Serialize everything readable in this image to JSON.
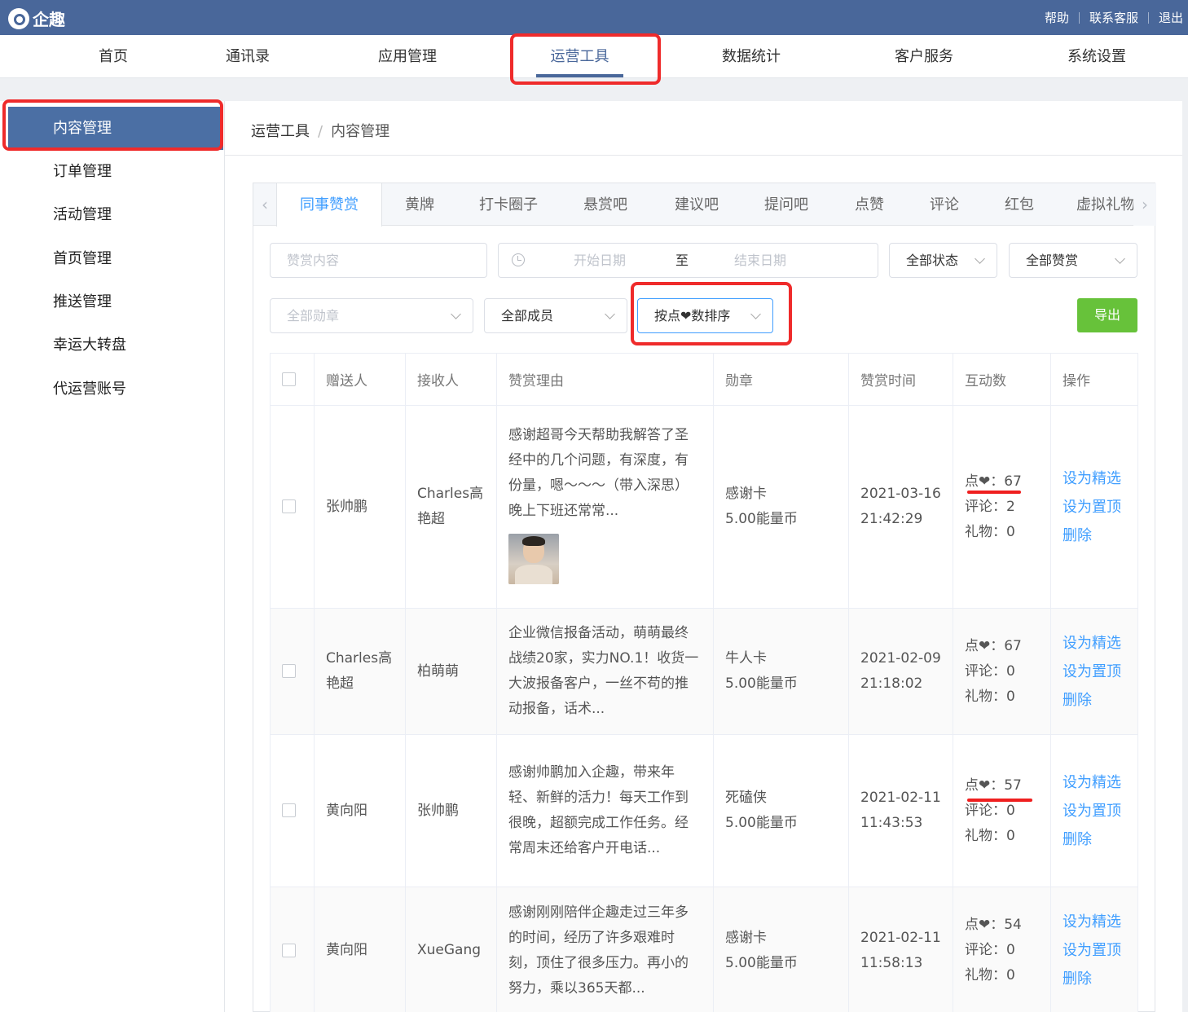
{
  "header": {
    "logo_text": "企趣",
    "links": [
      "帮助",
      "联系客服",
      "退出"
    ]
  },
  "nav": {
    "items": [
      "首页",
      "通讯录",
      "应用管理",
      "运营工具",
      "数据统计",
      "客户服务",
      "系统设置"
    ],
    "active": "运营工具"
  },
  "sidebar": {
    "items": [
      "内容管理",
      "订单管理",
      "活动管理",
      "首页管理",
      "推送管理",
      "幸运大转盘",
      "代运营账号"
    ],
    "active": "内容管理"
  },
  "breadcrumb": {
    "parent": "运营工具",
    "separator": "/",
    "current": "内容管理"
  },
  "tabs": {
    "items": [
      "同事赞赏",
      "黄牌",
      "打卡圈子",
      "悬赏吧",
      "建议吧",
      "提问吧",
      "点赞",
      "评论",
      "红包",
      "虚拟礼物"
    ],
    "active": "同事赞赏"
  },
  "filters": {
    "content_placeholder": "赞赏内容",
    "start_date_placeholder": "开始日期",
    "date_separator": "至",
    "end_date_placeholder": "结束日期",
    "status": "全部状态",
    "praise_type": "全部赞赏",
    "medal_placeholder": "全部勋章",
    "member": "全部成员",
    "sort": "按点❤数排序",
    "export_label": "导出"
  },
  "table": {
    "headers": [
      "赠送人",
      "接收人",
      "赞赏理由",
      "勋章",
      "赞赏时间",
      "互动数",
      "操作"
    ],
    "rows": [
      {
        "sender": "张帅鹏",
        "receiver": "Charles高艳超",
        "reason": "感谢超哥今天帮助我解答了圣经中的几个问题，有深度，有份量，嗯～～～（带入深思） 晚上下班还常常...",
        "has_image": true,
        "medal": "感谢卡",
        "coins": "5.00能量币",
        "date": "2021-03-16",
        "time": "21:42:29",
        "likes": "点❤：67",
        "comments": "评论：2",
        "gifts": "礼物：0"
      },
      {
        "sender": "Charles高艳超",
        "receiver": "柏萌萌",
        "reason": "企业微信报备活动，萌萌最终战绩20家，实力NO.1！收货一大波报备客户，一丝不苟的推动报备，话术...",
        "has_image": false,
        "medal": "牛人卡",
        "coins": "5.00能量币",
        "date": "2021-02-09",
        "time": "21:18:02",
        "likes": "点❤：67",
        "comments": "评论：0",
        "gifts": "礼物：0"
      },
      {
        "sender": "黄向阳",
        "receiver": "张帅鹏",
        "reason": "感谢帅鹏加入企趣，带来年轻、新鲜的活力！每天工作到很晚，超额完成工作任务。经常周末还给客户开电话...",
        "has_image": false,
        "medal": "死磕侠",
        "coins": "5.00能量币",
        "date": "2021-02-11",
        "time": "11:43:53",
        "likes": "点❤：57",
        "comments": "评论：0",
        "gifts": "礼物：0"
      },
      {
        "sender": "黄向阳",
        "receiver": "XueGang",
        "reason": "感谢刚刚陪伴企趣走过三年多的时间，经历了许多艰难时刻，顶住了很多压力。再小的努力，乘以365天都...",
        "has_image": false,
        "medal": "感谢卡",
        "coins": "5.00能量币",
        "date": "2021-02-11",
        "time": "11:58:13",
        "likes": "点❤：54",
        "comments": "评论：0",
        "gifts": "礼物：0"
      }
    ],
    "actions": [
      "设为精选",
      "设为置顶",
      "删除"
    ]
  },
  "colors": {
    "topbar": "#49679a",
    "sidebar_active": "#4b6fa4",
    "link": "#409eff",
    "export": "#67c23a",
    "highlight": "#ef2b2b"
  }
}
